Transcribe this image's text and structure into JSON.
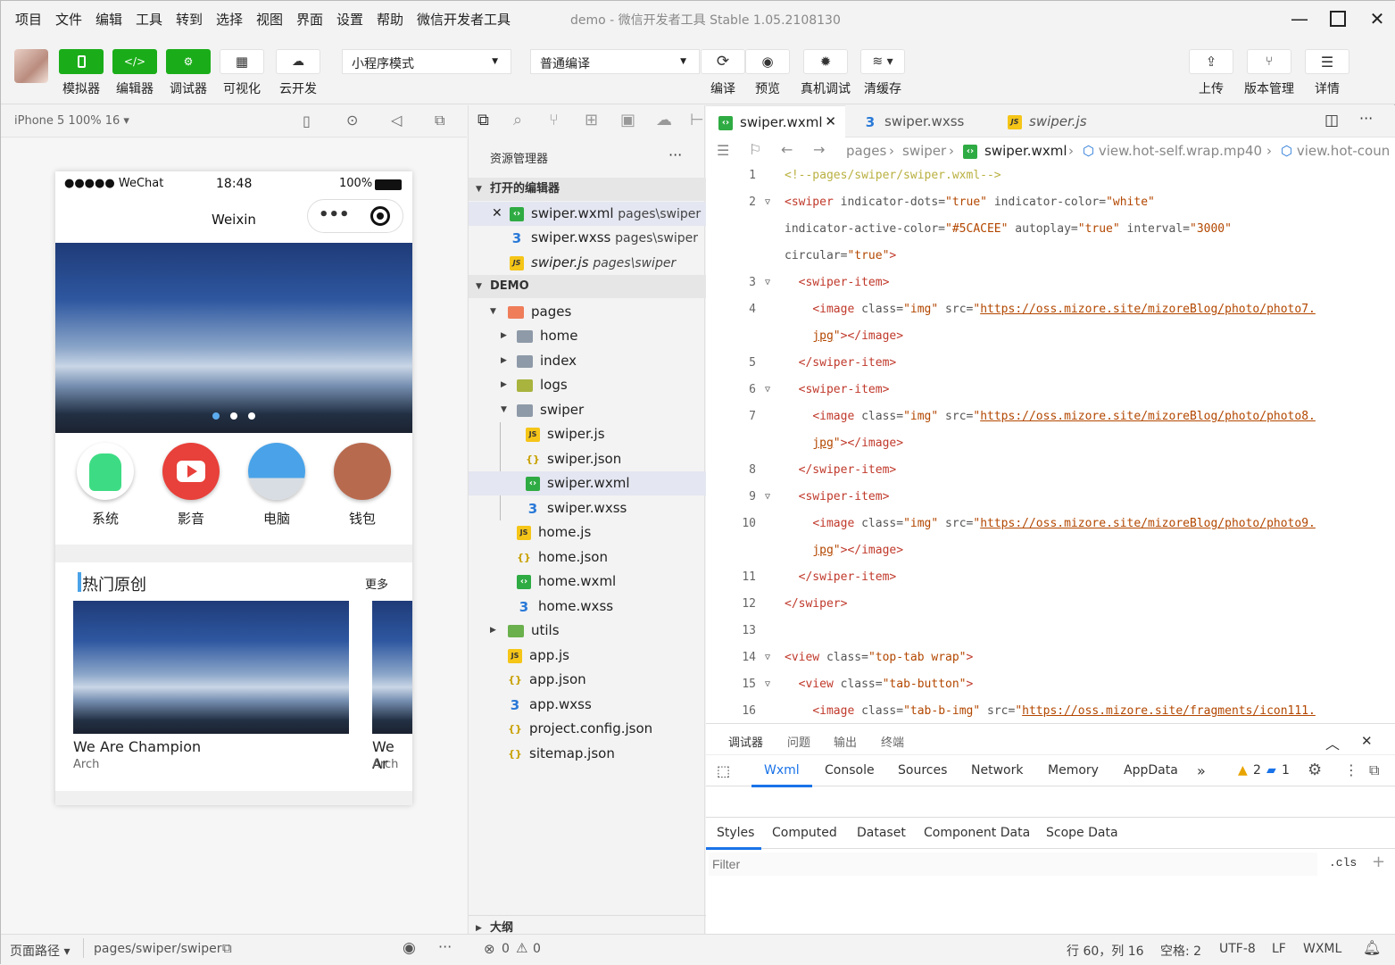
{
  "menubar": {
    "items": [
      "项目",
      "文件",
      "编辑",
      "工具",
      "转到",
      "选择",
      "视图",
      "界面",
      "设置",
      "帮助",
      "微信开发者工具"
    ],
    "title": "demo - 微信开发者工具 Stable 1.05.2108130"
  },
  "toolbar": {
    "buttons": [
      "模拟器",
      "编辑器",
      "调试器",
      "可视化",
      "云开发"
    ],
    "mode_select": "小程序模式",
    "compile_select": "普通编译",
    "actions": [
      "编译",
      "预览",
      "真机调试",
      "清缓存"
    ],
    "right_actions": [
      "上传",
      "版本管理",
      "详情"
    ]
  },
  "simulator": {
    "device": "iPhone 5 100% 16 ▾",
    "status_carrier": "●●●●● WeChat",
    "status_time": "18:48",
    "status_battery": "100%",
    "nav_title": "Weixin",
    "categories": [
      "系统",
      "影音",
      "电脑",
      "钱包"
    ],
    "section_title": "热门原创",
    "more": "更多",
    "card_title": "We Are Champion",
    "card_author": "Arch",
    "card2_title": "We Ar",
    "card2_author": "Arch"
  },
  "explorer": {
    "title": "资源管理器",
    "more": "···",
    "open_editors": "打开的编辑器",
    "open_files": [
      {
        "name": "swiper.wxml",
        "path": "pages\\swiper"
      },
      {
        "name": "swiper.wxss",
        "path": "pages\\swiper"
      },
      {
        "name": "swiper.js",
        "path": "pages\\swiper"
      }
    ],
    "project": "DEMO",
    "tree": [
      "pages",
      "home",
      "index",
      "logs",
      "swiper",
      "swiper.js",
      "swiper.json",
      "swiper.wxml",
      "swiper.wxss",
      "home.js",
      "home.json",
      "home.wxml",
      "home.wxss",
      "utils",
      "app.js",
      "app.json",
      "app.wxss",
      "project.config.json",
      "sitemap.json"
    ],
    "outline": "大纲",
    "problems_errors": "0",
    "problems_warnings": "0"
  },
  "editor": {
    "tabs": [
      "swiper.wxml",
      "swiper.wxss",
      "swiper.js"
    ],
    "breadcrumb": [
      "pages",
      "swiper",
      "swiper.wxml",
      "view.hot-self.wrap.mp40",
      "view.hot-coun"
    ],
    "line_numbers": [
      "1",
      "2",
      "",
      "",
      "3",
      "4",
      "",
      "5",
      "6",
      "7",
      "",
      "8",
      "9",
      "10",
      "",
      "11",
      "12",
      "13",
      "14",
      "15",
      "16"
    ]
  },
  "debug": {
    "top_tabs": [
      "调试器",
      "问题",
      "输出",
      "终端"
    ],
    "tabs": [
      "Wxml",
      "Console",
      "Sources",
      "Network",
      "Memory",
      "AppData"
    ],
    "more_tabs": "»",
    "warnings": "2",
    "infos": "1",
    "style_tabs": [
      "Styles",
      "Computed",
      "Dataset",
      "Component Data",
      "Scope Data"
    ],
    "filter_placeholder": "Filter",
    "cls": ".cls",
    "plus": "+"
  },
  "bottombar": {
    "page_path_label": "页面路径 ▾",
    "page_path": "pages/swiper/swiper",
    "cursor": "行 60，列 16",
    "spaces": "空格: 2",
    "encoding": "UTF-8",
    "eol": "LF",
    "language": "WXML"
  }
}
